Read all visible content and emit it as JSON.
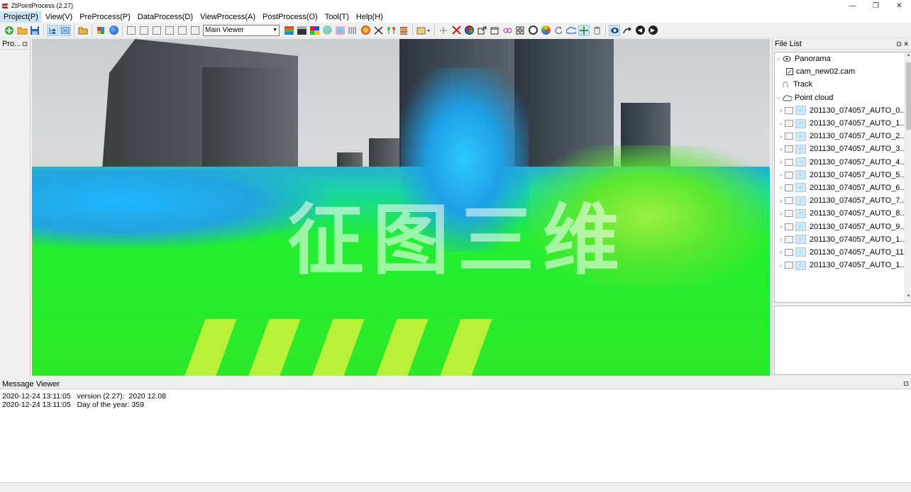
{
  "window": {
    "title": "ZtPointProcess (2.27)",
    "controls": [
      "—",
      "❐",
      "✕"
    ]
  },
  "menu": [
    {
      "label": "Project(P)"
    },
    {
      "label": "View(V)"
    },
    {
      "label": "PreProcess(P)"
    },
    {
      "label": "DataProcess(D)"
    },
    {
      "label": "ViewProcess(A)"
    },
    {
      "label": "PostProcess(O)"
    },
    {
      "label": "Tool(T)"
    },
    {
      "label": "Help(H)"
    }
  ],
  "toolbar": {
    "viewer_select": "Main Viewer"
  },
  "left_panel": {
    "title": "Pro..."
  },
  "viewport": {
    "watermark": "征图三维"
  },
  "file_list": {
    "title": "File List",
    "panorama_label": "Panorama",
    "cam_file": "cam_new02.cam",
    "track_label": "Track",
    "point_cloud_label": "Point cloud",
    "files": [
      "201130_074057_AUTO_0....",
      "201130_074057_AUTO_1....",
      "201130_074057_AUTO_2....",
      "201130_074057_AUTO_3....",
      "201130_074057_AUTO_4....",
      "201130_074057_AUTO_5....",
      "201130_074057_AUTO_6....",
      "201130_074057_AUTO_7....",
      "201130_074057_AUTO_8....",
      "201130_074057_AUTO_9....",
      "201130_074057_AUTO_1...",
      "201130_074057_AUTO_11...",
      "201130_074057_AUTO_1..."
    ]
  },
  "message_viewer": {
    "title": "Message Viewer",
    "lines": [
      "2020-12-24 13:11:05   version (2.27):  2020 12.08",
      "2020-12-24 13:11:05   Day of the year: 359"
    ]
  }
}
